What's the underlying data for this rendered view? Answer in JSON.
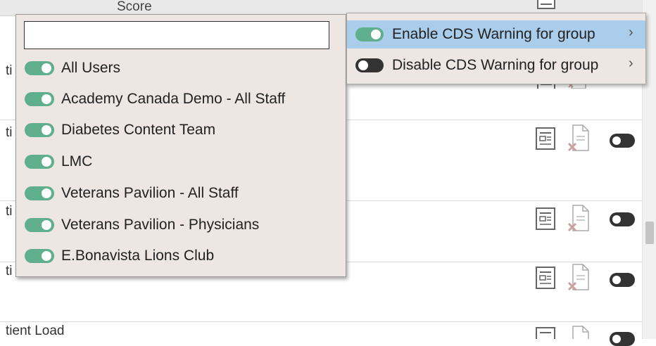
{
  "table": {
    "header_score": "Score",
    "cut_labels": [
      "ti",
      "ti",
      "ti",
      "ti"
    ],
    "last_row_label": "tient Load"
  },
  "group_menu": {
    "search_value": "",
    "groups": [
      {
        "label": "All Users",
        "enabled": true
      },
      {
        "label": "Academy Canada Demo - All Staff",
        "enabled": true
      },
      {
        "label": "Diabetes Content Team",
        "enabled": true
      },
      {
        "label": "LMC",
        "enabled": true
      },
      {
        "label": "Veterans Pavilion - All Staff",
        "enabled": true
      },
      {
        "label": "Veterans Pavilion - Physicians",
        "enabled": true
      },
      {
        "label": "E.Bonavista Lions Club",
        "enabled": true
      }
    ]
  },
  "context_menu": {
    "items": [
      {
        "label": "Enable CDS Warning for group",
        "chevron": "›",
        "highlighted": true
      },
      {
        "label": "Disable CDS Warning for group",
        "chevron": "›",
        "highlighted": false
      }
    ]
  },
  "colors": {
    "toggle_on": "#5fae8c",
    "toggle_off": "#333333",
    "menu_bg": "#ede6e3",
    "highlight": "#a9cdea"
  },
  "icons": [
    "report-icon",
    "remove-document-icon",
    "toggle-icon",
    "chevron-right-icon"
  ]
}
